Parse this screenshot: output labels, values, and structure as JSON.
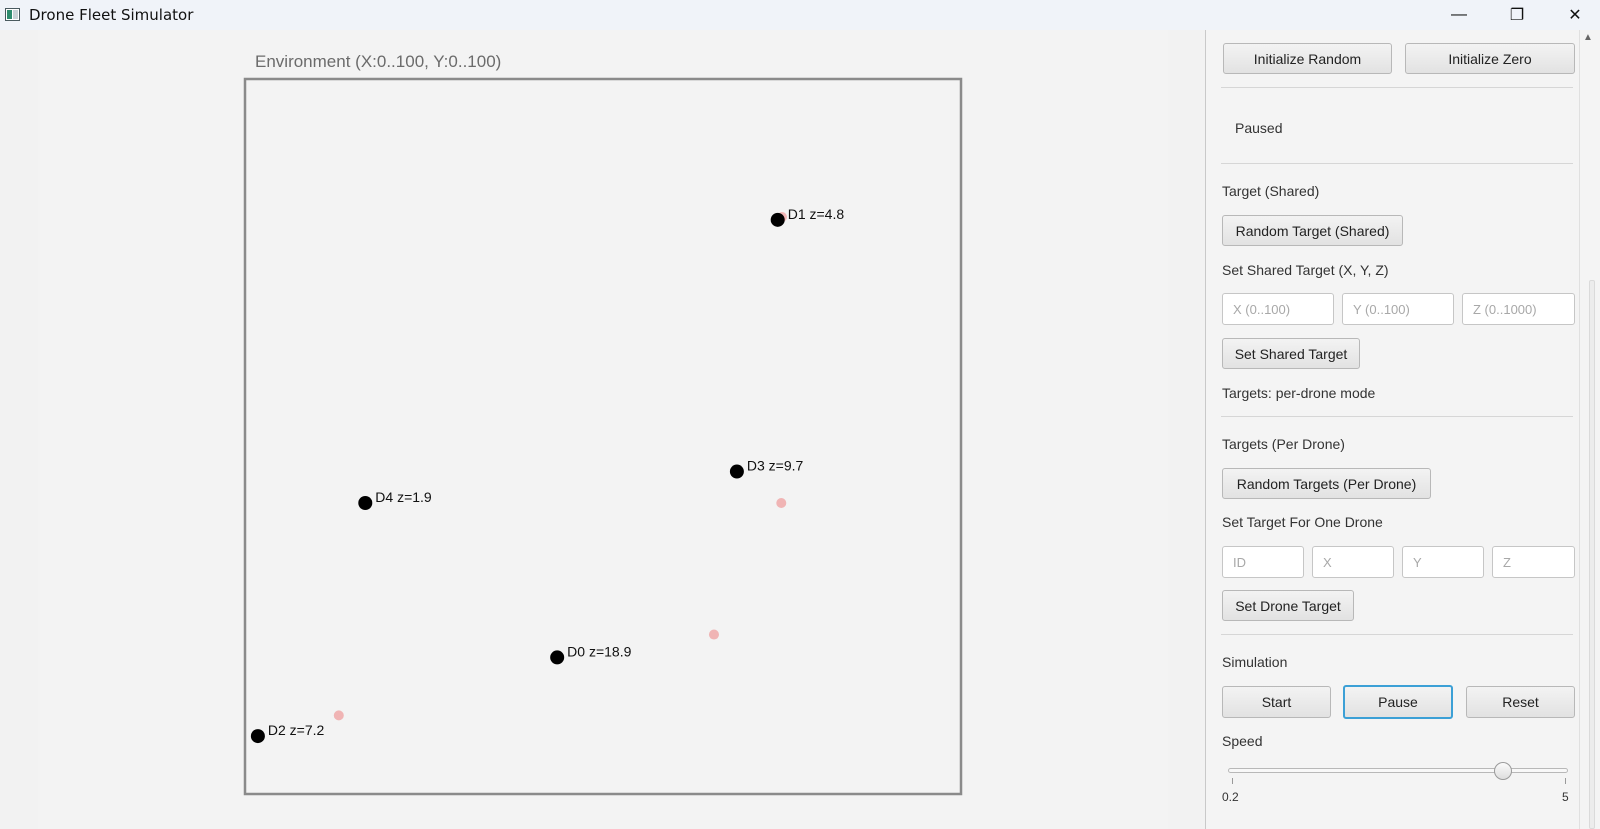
{
  "window": {
    "title": "Drone Fleet Simulator",
    "minimize_glyph": "—",
    "maximize_glyph": "❐",
    "close_glyph": "✕"
  },
  "environment": {
    "label": "Environment (X:0..100, Y:0..100)",
    "x_range": [
      0,
      100
    ],
    "y_range": [
      0,
      100
    ],
    "drones": [
      {
        "id": "D0",
        "label": "D0 z=18.9",
        "x": 43.6,
        "y": 19.1,
        "z": 18.9
      },
      {
        "id": "D1",
        "label": "D1 z=4.8",
        "x": 74.4,
        "y": 80.3,
        "z": 4.8
      },
      {
        "id": "D2",
        "label": "D2 z=7.2",
        "x": 1.8,
        "y": 8.1,
        "z": 7.2
      },
      {
        "id": "D3",
        "label": "D3 z=9.7",
        "x": 68.7,
        "y": 45.1,
        "z": 9.7
      },
      {
        "id": "D4",
        "label": "D4 z=1.9",
        "x": 16.8,
        "y": 40.7,
        "z": 1.9
      }
    ],
    "targets": [
      {
        "x": 75.0,
        "y": 80.7
      },
      {
        "x": 74.9,
        "y": 40.7
      },
      {
        "x": 65.5,
        "y": 22.3
      },
      {
        "x": 13.1,
        "y": 11.0
      }
    ],
    "drone_color": "#000000",
    "target_color": "#f0b4b4"
  },
  "panel": {
    "init_random": "Initialize Random",
    "init_zero": "Initialize Zero",
    "status": "Paused",
    "shared_heading": "Target (Shared)",
    "random_shared": "Random Target (Shared)",
    "set_shared_heading": "Set Shared Target (X, Y, Z)",
    "shared_x_placeholder": "X (0..100)",
    "shared_y_placeholder": "Y (0..100)",
    "shared_z_placeholder": "Z (0..1000)",
    "set_shared": "Set Shared Target",
    "targets_mode": "Targets: per-drone mode",
    "per_drone_heading": "Targets (Per Drone)",
    "random_per_drone": "Random Targets (Per Drone)",
    "set_one_heading": "Set Target For One Drone",
    "id_placeholder": "ID",
    "x_placeholder": "X",
    "y_placeholder": "Y",
    "z_placeholder": "Z",
    "set_drone_target": "Set Drone Target",
    "simulation_heading": "Simulation",
    "start": "Start",
    "pause": "Pause",
    "reset": "Reset",
    "speed_heading": "Speed",
    "speed_min": "0.2",
    "speed_max": "5",
    "speed_value": 4.1
  }
}
